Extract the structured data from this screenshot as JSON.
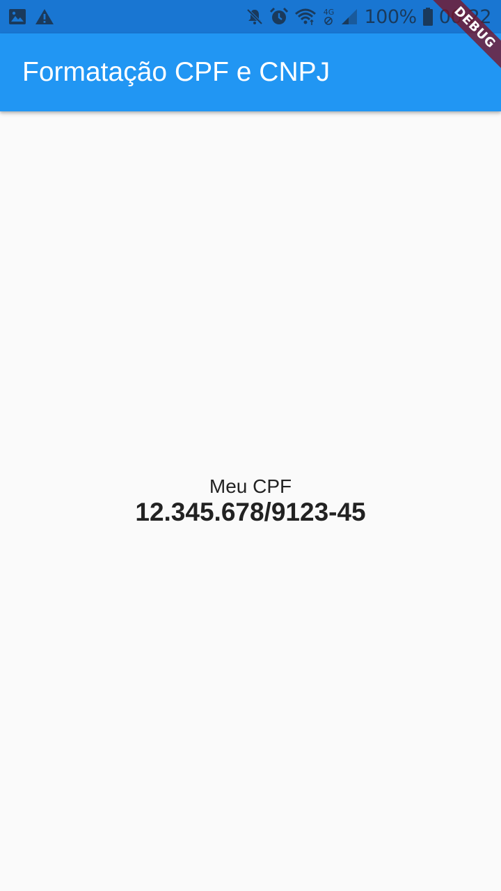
{
  "status_bar": {
    "battery_percent": "100%",
    "time": "00:22",
    "network_label": "4G",
    "icons": [
      "image-icon",
      "warning-icon",
      "mute-icon",
      "alarm-icon",
      "wifi-icon",
      "network-4g-icon",
      "signal-icon",
      "battery-icon"
    ]
  },
  "app_bar": {
    "title": "Formatação CPF e CNPJ",
    "color": "#2196f3"
  },
  "main": {
    "cpf_label": "Meu CPF",
    "cpf_value": "12.345.678/9123-45"
  },
  "debug_banner": {
    "label": "DEBUG",
    "color": "#7a1428"
  }
}
